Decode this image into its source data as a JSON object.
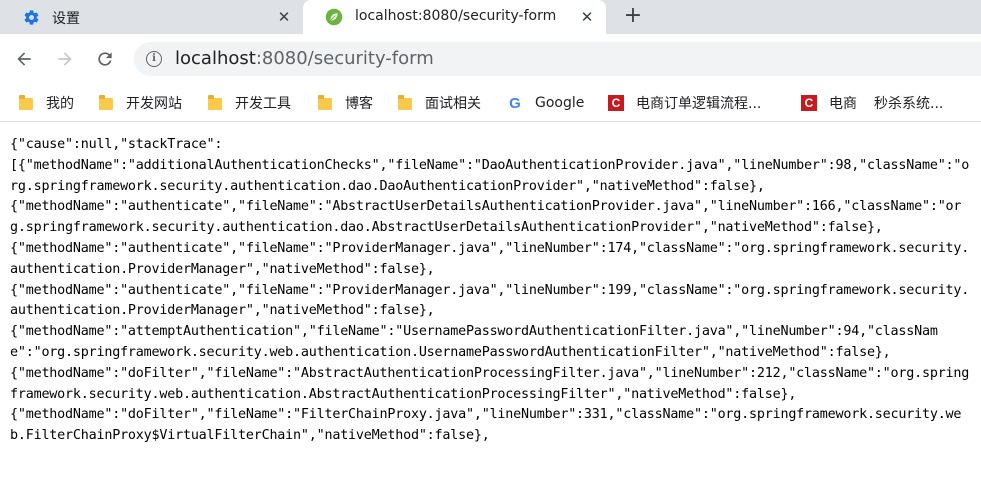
{
  "tabs": [
    {
      "title": "设置",
      "icon": "gear-icon",
      "active": false,
      "close": "✕"
    },
    {
      "title": "localhost:8080/security-form",
      "icon": "spring-leaf-icon",
      "active": true,
      "close": "✕"
    }
  ],
  "new_tab_label": "+",
  "address_bar": {
    "host": "localhost",
    "rest": ":8080/security-form"
  },
  "bookmarks": [
    {
      "label": "我的",
      "icon": "folder-icon"
    },
    {
      "label": "开发网站",
      "icon": "folder-icon"
    },
    {
      "label": "开发工具",
      "icon": "folder-icon"
    },
    {
      "label": "博客",
      "icon": "folder-icon"
    },
    {
      "label": "面试相关",
      "icon": "folder-icon"
    },
    {
      "label": "Google",
      "icon": "google-icon"
    },
    {
      "label": "电商订单逻辑流程...",
      "icon": "csdn-icon"
    },
    {
      "label": "电商",
      "icon": "csdn-icon"
    },
    {
      "label": "秒杀系统...",
      "icon": ""
    }
  ],
  "content": {
    "json_response": "{\"cause\":null,\"stackTrace\":\n[{\"methodName\":\"additionalAuthenticationChecks\",\"fileName\":\"DaoAuthenticationProvider.java\",\"lineNumber\":98,\"className\":\"org.springframework.security.authentication.dao.DaoAuthenticationProvider\",\"nativeMethod\":false},\n{\"methodName\":\"authenticate\",\"fileName\":\"AbstractUserDetailsAuthenticationProvider.java\",\"lineNumber\":166,\"className\":\"org.springframework.security.authentication.dao.AbstractUserDetailsAuthenticationProvider\",\"nativeMethod\":false},\n{\"methodName\":\"authenticate\",\"fileName\":\"ProviderManager.java\",\"lineNumber\":174,\"className\":\"org.springframework.security.authentication.ProviderManager\",\"nativeMethod\":false},\n{\"methodName\":\"authenticate\",\"fileName\":\"ProviderManager.java\",\"lineNumber\":199,\"className\":\"org.springframework.security.authentication.ProviderManager\",\"nativeMethod\":false},\n{\"methodName\":\"attemptAuthentication\",\"fileName\":\"UsernamePasswordAuthenticationFilter.java\",\"lineNumber\":94,\"className\":\"org.springframework.security.web.authentication.UsernamePasswordAuthenticationFilter\",\"nativeMethod\":false},\n{\"methodName\":\"doFilter\",\"fileName\":\"AbstractAuthenticationProcessingFilter.java\",\"lineNumber\":212,\"className\":\"org.springframework.security.web.authentication.AbstractAuthenticationProcessingFilter\",\"nativeMethod\":false},\n{\"methodName\":\"doFilter\",\"fileName\":\"FilterChainProxy.java\",\"lineNumber\":331,\"className\":\"org.springframework.security.web.FilterChainProxy$VirtualFilterChain\",\"nativeMethod\":false},"
  }
}
